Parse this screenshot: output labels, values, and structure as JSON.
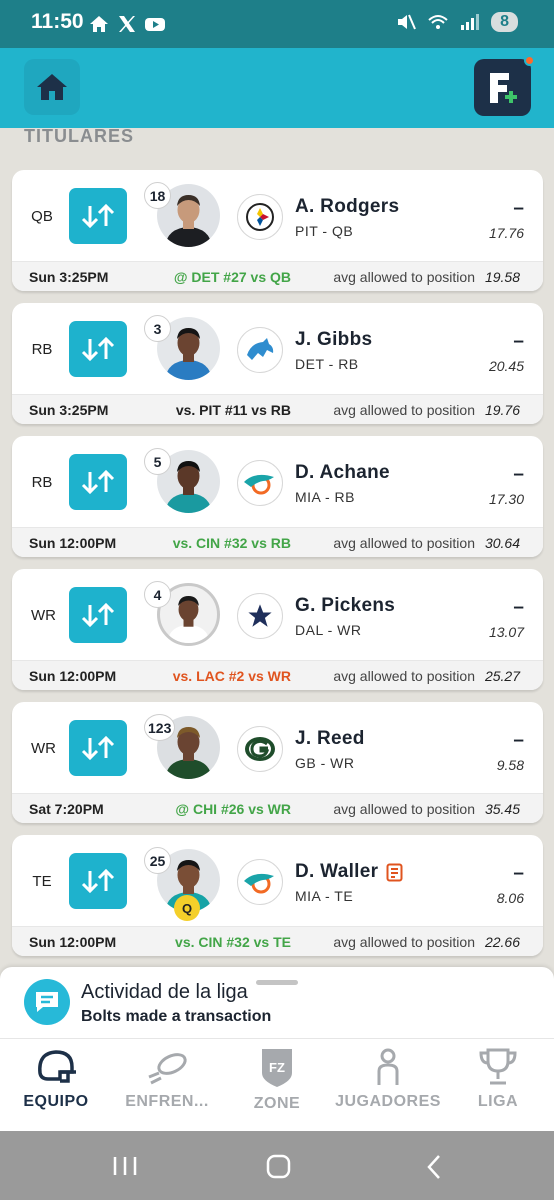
{
  "status_bar": {
    "time": "11:50",
    "battery": "8"
  },
  "section_title": "TITULARES",
  "players": [
    {
      "position": "QB",
      "jersey": "18",
      "name": "A. Rodgers",
      "team_pos": "PIT - QB",
      "score": "–",
      "projection": "17.76",
      "game_time": "Sun 3:25PM",
      "matchup": "@ DET #27 vs QB",
      "matchup_color": "green",
      "avg_label": "avg allowed to position",
      "avg_value": "19.58",
      "team_logo": "steelers-logo",
      "has_news": false,
      "status_badge": ""
    },
    {
      "position": "RB",
      "jersey": "3",
      "name": "J. Gibbs",
      "team_pos": "DET - RB",
      "score": "–",
      "projection": "20.45",
      "game_time": "Sun 3:25PM",
      "matchup": "vs. PIT #11 vs RB",
      "matchup_color": "dark",
      "avg_label": "avg allowed to position",
      "avg_value": "19.76",
      "team_logo": "lions-logo",
      "has_news": false,
      "status_badge": ""
    },
    {
      "position": "RB",
      "jersey": "5",
      "name": "D. Achane",
      "team_pos": "MIA - RB",
      "score": "–",
      "projection": "17.30",
      "game_time": "Sun 12:00PM",
      "matchup": "vs. CIN #32 vs RB",
      "matchup_color": "green",
      "avg_label": "avg allowed to position",
      "avg_value": "30.64",
      "team_logo": "dolphins-logo",
      "has_news": false,
      "status_badge": ""
    },
    {
      "position": "WR",
      "jersey": "4",
      "name": "G. Pickens",
      "team_pos": "DAL - WR",
      "score": "–",
      "projection": "13.07",
      "game_time": "Sun 12:00PM",
      "matchup": "vs. LAC #2 vs WR",
      "matchup_color": "red",
      "avg_label": "avg allowed to position",
      "avg_value": "25.27",
      "team_logo": "cowboys-logo",
      "has_news": false,
      "status_badge": ""
    },
    {
      "position": "WR",
      "jersey": "123",
      "name": "J. Reed",
      "team_pos": "GB - WR",
      "score": "–",
      "projection": "9.58",
      "game_time": "Sat 7:20PM",
      "matchup": "@ CHI #26 vs WR",
      "matchup_color": "green",
      "avg_label": "avg allowed to position",
      "avg_value": "35.45",
      "team_logo": "packers-logo",
      "has_news": false,
      "status_badge": ""
    },
    {
      "position": "TE",
      "jersey": "25",
      "name": "D. Waller",
      "team_pos": "MIA - TE",
      "score": "–",
      "projection": "8.06",
      "game_time": "Sun 12:00PM",
      "matchup": "vs. CIN #32 vs TE",
      "matchup_color": "green",
      "avg_label": "avg allowed to position",
      "avg_value": "22.66",
      "team_logo": "dolphins-logo",
      "has_news": true,
      "status_badge": "Q"
    }
  ],
  "activity": {
    "title": "Actividad de la liga",
    "subtitle": "Bolts made a transaction"
  },
  "nav": [
    {
      "label": "EQUIPO",
      "icon": "helmet-icon",
      "active": true
    },
    {
      "label": "ENFREN...",
      "icon": "football-icon",
      "active": false
    },
    {
      "label": "ZONE",
      "icon": "fz-shield-icon",
      "active": false
    },
    {
      "label": "JUGADORES",
      "icon": "person-icon",
      "active": false
    },
    {
      "label": "LIGA",
      "icon": "trophy-icon",
      "active": false
    }
  ],
  "colors": {
    "accent": "#21b4cc",
    "swap_button": "#1eb2cd",
    "navy": "#1d3048",
    "good_matchup": "#43a548",
    "bad_matchup": "#e0541f"
  }
}
